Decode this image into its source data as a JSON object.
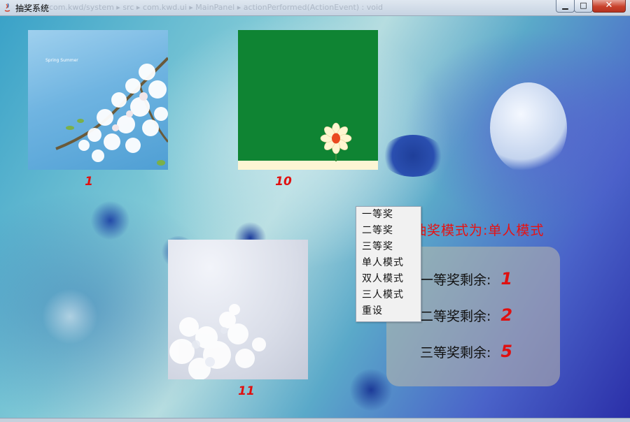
{
  "window": {
    "title": "抽奖系统",
    "background_ghost_text": "com.kwd/system ▸ src ▸ com.kwd.ui ▸ MainPanel ▸ actionPerformed(ActionEvent) : void"
  },
  "prizes": [
    {
      "label": "1",
      "picture": "cherry-blossom-photo",
      "picture_text": "Spring Summer"
    },
    {
      "label": "10",
      "picture": "daisy-on-green-picture"
    },
    {
      "label": "11",
      "picture": "snow-crystal-photo"
    }
  ],
  "mode_text": "抽奖模式为:单人模式",
  "remaining": [
    {
      "label": "一等奖剩余:",
      "value": "1"
    },
    {
      "label": "二等奖剩余:",
      "value": "2"
    },
    {
      "label": "三等奖剩余:",
      "value": "5"
    }
  ],
  "context_menu": {
    "items": [
      "一等奖",
      "二等奖",
      "三等奖",
      "单人模式",
      "双人模式",
      "三人模式",
      "重设"
    ]
  },
  "colors": {
    "accent_red": "#e01010",
    "menu_bg": "#f1f1f1",
    "green_card": "#0f8433"
  }
}
